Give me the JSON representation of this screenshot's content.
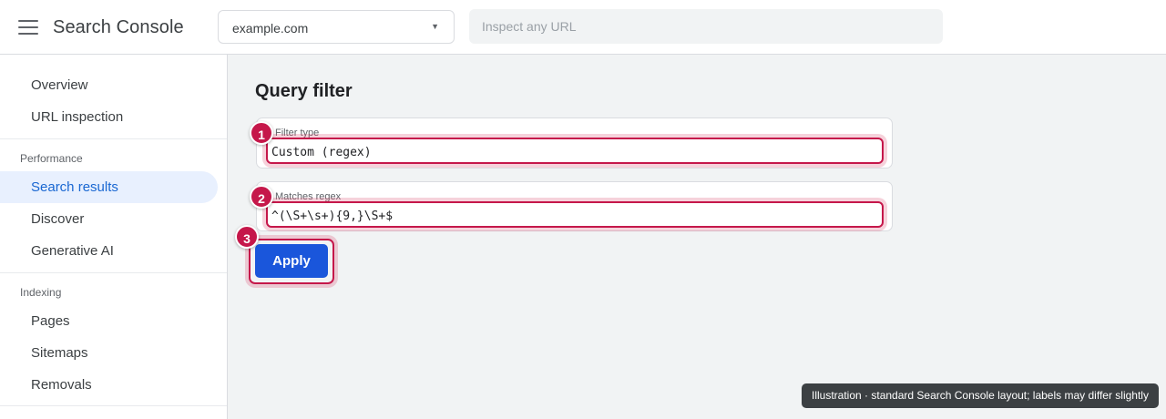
{
  "header": {
    "app_title": "Search Console",
    "menu_icon": "hamburger-menu-icon",
    "property": "example.com",
    "property_caret_icon": "triangle-down-icon",
    "inspect_placeholder": "Inspect any URL"
  },
  "sidebar": {
    "top_items": [
      {
        "label": "Overview"
      },
      {
        "label": "URL inspection"
      }
    ],
    "performance": {
      "label": "Performance",
      "items": [
        {
          "label": "Search results",
          "active": true
        },
        {
          "label": "Discover"
        },
        {
          "label": "Generative AI"
        }
      ]
    },
    "indexing": {
      "label": "Indexing",
      "items": [
        {
          "label": "Pages"
        },
        {
          "label": "Sitemaps"
        },
        {
          "label": "Removals"
        }
      ]
    }
  },
  "main": {
    "title": "Query filter",
    "filter_type": {
      "label": "Filter type",
      "value": "Custom (regex)"
    },
    "matches_regex": {
      "label": "Matches regex",
      "value": "^(\\S+\\s+){9,}\\S+$"
    },
    "apply_label": "Apply"
  },
  "steps": [
    "1",
    "2",
    "3"
  ],
  "note": "Illustration · standard Search Console layout; labels may differ slightly",
  "colors": {
    "accent": "#1a56db",
    "highlight": "#c5174a",
    "active_nav_bg": "#e8f0fe"
  }
}
